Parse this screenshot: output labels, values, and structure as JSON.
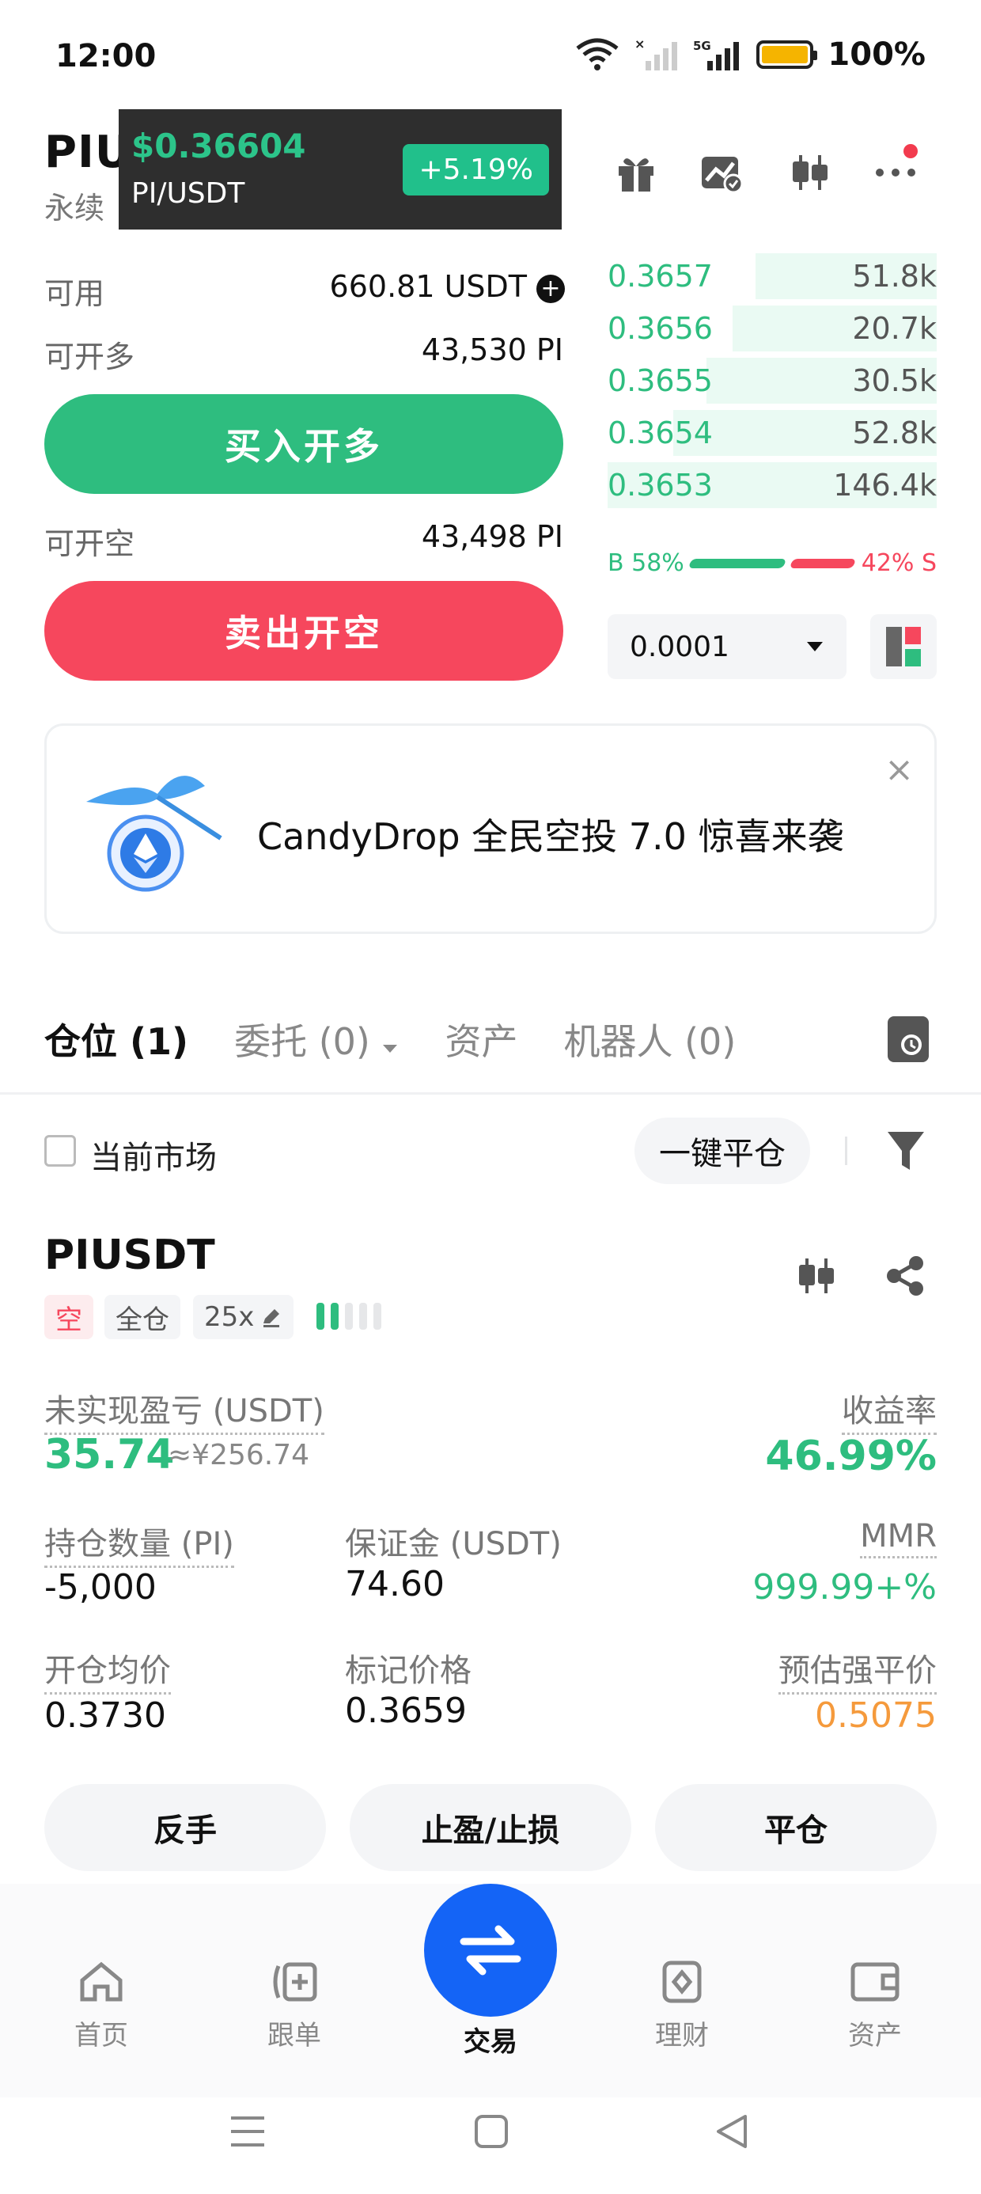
{
  "status_bar": {
    "time": "12:00",
    "battery": "100%",
    "network": "5G"
  },
  "header": {
    "symbol": "PIUSDT",
    "contract_type": "永续",
    "popup": {
      "price": "$0.36604",
      "pair": "PI/USDT",
      "change": "+5.19%"
    },
    "icons": [
      "gift-icon",
      "chart-settings-icon",
      "candlestick-icon",
      "more-icon"
    ]
  },
  "order_panel": {
    "available_label": "可用",
    "available_value": "660.81  USDT",
    "can_long_label": "可开多",
    "can_long_value": "43,530 PI",
    "buy_button": "买入开多",
    "can_short_label": "可开空",
    "can_short_value": "43,498 PI",
    "sell_button": "卖出开空"
  },
  "order_book": {
    "rows": [
      {
        "price": "0.3657",
        "size": "51.8k",
        "depth": 0.55
      },
      {
        "price": "0.3656",
        "size": "20.7k",
        "depth": 0.62
      },
      {
        "price": "0.3655",
        "size": "30.5k",
        "depth": 0.7
      },
      {
        "price": "0.3654",
        "size": "52.8k",
        "depth": 0.8
      },
      {
        "price": "0.3653",
        "size": "146.4k",
        "depth": 1.0
      }
    ],
    "buy_ratio": "B 58%",
    "sell_ratio": "42% S",
    "tick_size": "0.0001"
  },
  "banner": {
    "text": "CandyDrop 全民空投 7.0 惊喜来袭",
    "close": "×"
  },
  "tabs": [
    {
      "label": "仓位 (1)",
      "active": true
    },
    {
      "label": "委托 (0)",
      "active": false
    },
    {
      "label": "资产",
      "active": false
    },
    {
      "label": "机器人 (0)",
      "active": false
    }
  ],
  "filter_bar": {
    "current_market": "当前市场",
    "close_all": "一键平仓"
  },
  "position": {
    "symbol": "PIUSDT",
    "side": "空",
    "margin_mode": "全仓",
    "leverage": "25x",
    "unrealized_pnl_label": "未实现盈亏 (USDT)",
    "unrealized_pnl": "35.74",
    "unrealized_pnl_cny": "≈¥256.74",
    "roi_label": "收益率",
    "roi": "46.99%",
    "size_label": "持仓数量 (PI)",
    "size": "-5,000",
    "margin_label": "保证金 (USDT)",
    "margin": "74.60",
    "mmr_label": "MMR",
    "mmr": "999.99+%",
    "entry_label": "开仓均价",
    "entry": "0.3730",
    "mark_label": "标记价格",
    "mark": "0.3659",
    "liq_label": "预估强平价",
    "liq": "0.5075",
    "actions": [
      "反手",
      "止盈/止损",
      "平仓"
    ]
  },
  "bottom_nav": [
    {
      "label": "首页",
      "icon": "home-icon"
    },
    {
      "label": "跟单",
      "icon": "copy-trade-icon"
    },
    {
      "label": "交易",
      "icon": "trade-icon",
      "active": true
    },
    {
      "label": "理财",
      "icon": "finance-icon"
    },
    {
      "label": "资产",
      "icon": "wallet-icon"
    }
  ],
  "colors": {
    "green": "#2ebd7f",
    "red": "#f6475d",
    "blue": "#1464f6",
    "orange": "#f59a3c"
  }
}
